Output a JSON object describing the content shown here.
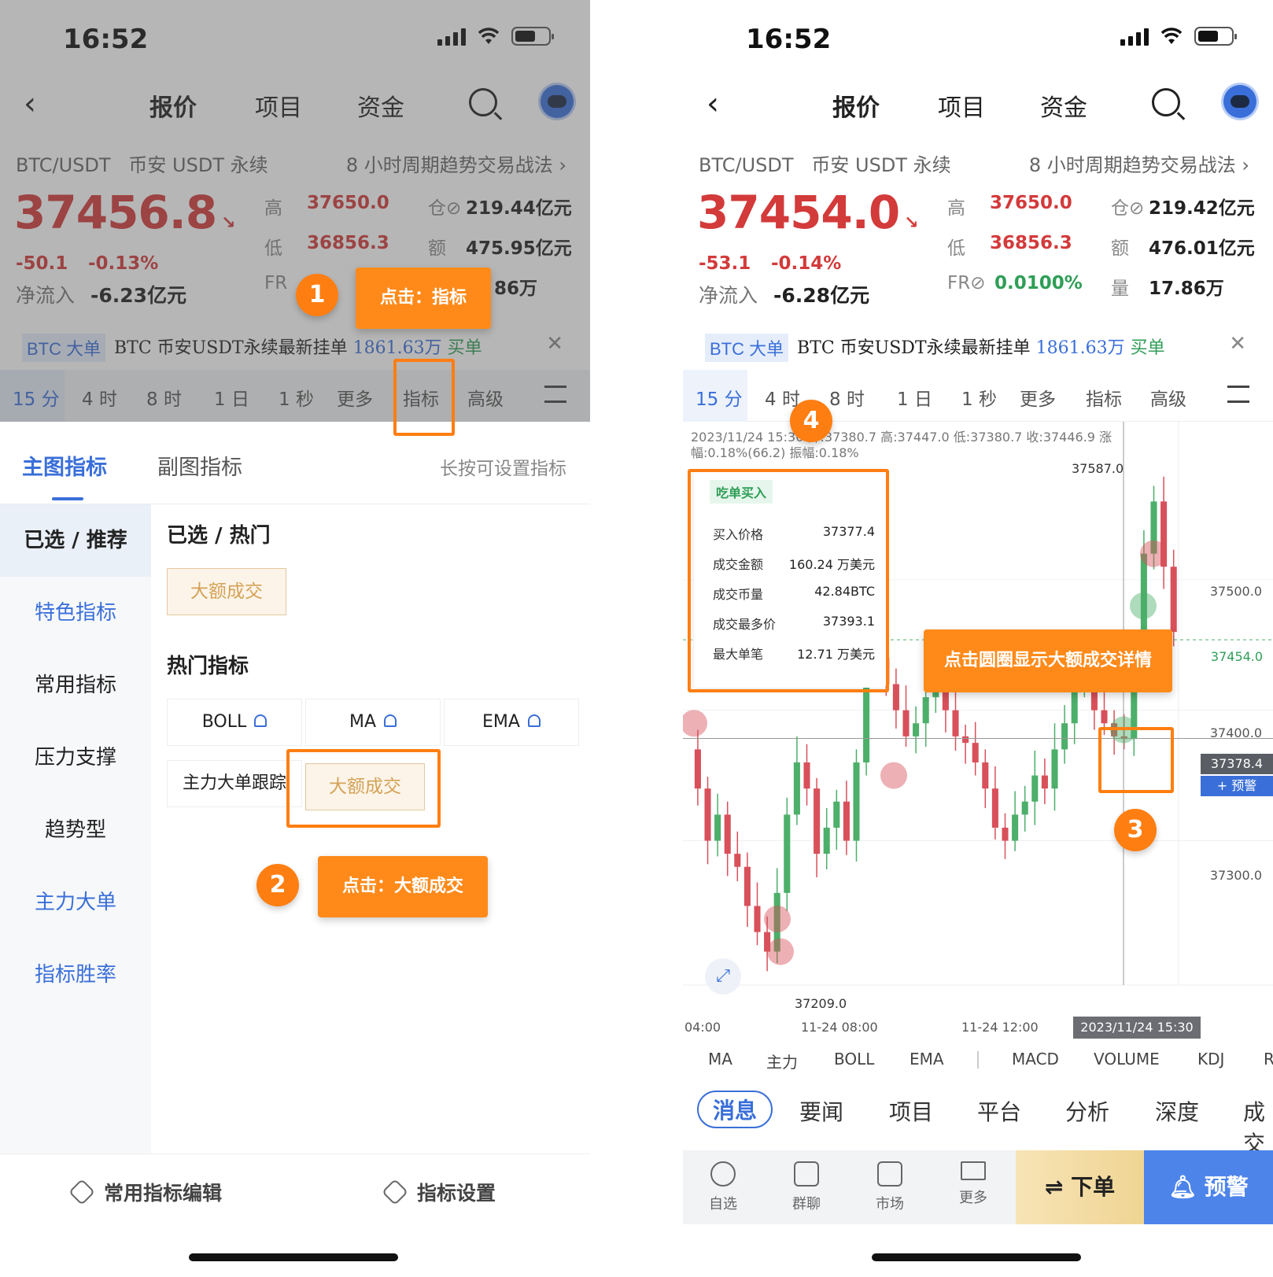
{
  "status": {
    "time": "16:52"
  },
  "nav": {
    "tabs": [
      "报价",
      "项目",
      "资金"
    ]
  },
  "header": {
    "pair": "BTC/USDT",
    "market": "币安 USDT 永续",
    "strategy": "8 小时周期趋势交易战法 ›"
  },
  "left_quote": {
    "price": "37456.8",
    "change": "-50.1",
    "change_pct": "-0.13%",
    "netflow_label": "净流入",
    "netflow_value": "-6.23亿元",
    "high_label": "高",
    "high": "37650.0",
    "low_label": "低",
    "low": "36856.3",
    "oi_label": "仓",
    "oi": "219.44亿元",
    "amt_label": "额",
    "amt": "475.95亿元",
    "fr_label": "FR",
    "fr": "0.0100%",
    "vol_label": "量",
    "vol": "17.86万",
    "vol_partial": "86万"
  },
  "right_quote": {
    "price": "37454.0",
    "change": "-53.1",
    "change_pct": "-0.14%",
    "netflow_label": "净流入",
    "netflow_value": "-6.28亿元",
    "high_label": "高",
    "high": "37650.0",
    "low_label": "低",
    "low": "36856.3",
    "oi_label": "仓",
    "oi": "219.42亿元",
    "amt_label": "额",
    "amt": "476.01亿元",
    "fr_label": "FR",
    "fr": "0.0100%",
    "vol_label": "量",
    "vol": "17.86万"
  },
  "ticker": {
    "tag": "BTC 大单",
    "text": "BTC 币安USDT永续最新挂单",
    "amount": "1861.63万",
    "side": "买单"
  },
  "timeframes": [
    "15 分",
    "4 时",
    "8 时",
    "1 日",
    "1 秒",
    "更多",
    "指标",
    "高级"
  ],
  "panel": {
    "tab_main": "主图指标",
    "tab_sub": "副图指标",
    "hint": "长按可设置指标",
    "sidebar": [
      "已选 / 推荐",
      "特色指标",
      "常用指标",
      "压力支撑",
      "趋势型",
      "主力大单",
      "指标胜率"
    ],
    "selected_title": "已选 / 热门",
    "selected_chip": "大额成交",
    "hot_title": "热门指标",
    "hot": [
      "BOLL",
      "MA",
      "EMA",
      "主力大单跟踪",
      "大额成交"
    ],
    "bottom_left": "常用指标编辑",
    "bottom_right": "指标设置"
  },
  "callouts": {
    "n1": "1",
    "l1": "点击：指标",
    "n2": "2",
    "l2": "点击：大额成交",
    "n3": "3",
    "n4": "4",
    "l4": "点击圆圈显示大额成交详情"
  },
  "chart": {
    "info_line1": "2023/11/24 15:30 开:37380.7 高:37447.0 低:37380.7 收:37446.9 涨",
    "info_line2": "幅:0.18%(66.2) 振幅:0.18%",
    "peak_label": "37587.0",
    "low_label": "37209.0",
    "y_ticks": [
      "37500.0",
      "37400.0",
      "37300.0"
    ],
    "current": "37454.0",
    "crosshair": "37378.4",
    "alert": "+ 预警",
    "x_ticks": [
      "04:00",
      "11-24 08:00",
      "11-24 12:00"
    ],
    "x_selected": "2023/11/24 15:30"
  },
  "chart_data": {
    "type": "candlestick",
    "y_axis_ticks": [
      37300.0,
      37400.0,
      37500.0
    ],
    "high_marker": 37587.0,
    "low_marker": 37209.0,
    "last_price": 37454.0,
    "crosshair_price": 37378.4,
    "selected_candle": {
      "time": "2023/11/24 15:30",
      "open": 37380.7,
      "high": 37447.0,
      "low": 37380.7,
      "close": 37446.9,
      "change_pct": "0.18%",
      "change": 66.2,
      "amplitude": "0.18%"
    },
    "colors": {
      "up": "#4caf6a",
      "down": "#d8505a"
    }
  },
  "tooltip": {
    "tag": "吃单买入",
    "rows": [
      {
        "k": "买入价格",
        "v": "37377.4"
      },
      {
        "k": "成交金额",
        "v": "160.24 万美元"
      },
      {
        "k": "成交币量",
        "v": "42.84BTC"
      },
      {
        "k": "成交最多价",
        "v": "37393.1"
      },
      {
        "k": "最大单笔",
        "v": "12.71 万美元"
      }
    ]
  },
  "indicators": [
    "MA",
    "主力",
    "BOLL",
    "EMA",
    "MACD",
    "VOLUME",
    "KDJ",
    "R"
  ],
  "news_tabs": [
    "消息",
    "要闻",
    "项目",
    "平台",
    "分析",
    "深度",
    "成交"
  ],
  "bottom_nav": {
    "items": [
      "自选",
      "群聊",
      "市场",
      "更多"
    ],
    "order": "下单",
    "alert": "预警"
  },
  "colors": {
    "accent": "#3a6fd9",
    "up": "#2f9e57",
    "down": "#d33a3a",
    "callout": "#ff7e12"
  }
}
